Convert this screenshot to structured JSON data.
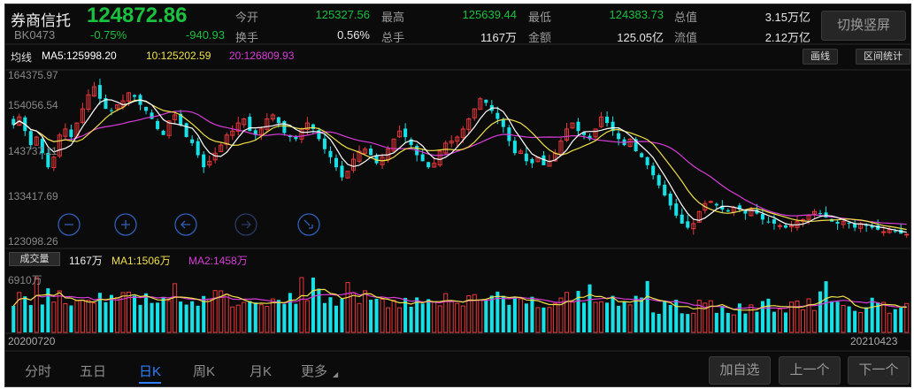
{
  "header": {
    "stock_name": "券商信托",
    "price": "124872.86",
    "code": "BK0473",
    "change_pct": "-0.75%",
    "change_abs": "-940.93",
    "stats": [
      {
        "label": "今开",
        "value": "125327.56",
        "color": "#19c13e"
      },
      {
        "label": "最高",
        "value": "125639.44",
        "color": "#19c13e"
      },
      {
        "label": "最低",
        "value": "124383.73",
        "color": "#19c13e"
      },
      {
        "label": "总值",
        "value": "3.15万亿",
        "color": "#e6e6e6"
      },
      {
        "label": "换手",
        "value": "0.56%",
        "color": "#e6e6e6"
      },
      {
        "label": "总手",
        "value": "1167万",
        "color": "#e6e6e6"
      },
      {
        "label": "金额",
        "value": "125.05亿",
        "color": "#e6e6e6"
      },
      {
        "label": "流值",
        "value": "2.12万亿",
        "color": "#e6e6e6"
      }
    ],
    "switch_button": "切换竖屏"
  },
  "ma_bar": {
    "title": "均线",
    "ma5": "MA5:125998.20",
    "ma10": "10:125202.59",
    "ma20": "20:126809.93",
    "draw_button": "画线",
    "range_button": "区间统计"
  },
  "price_axis": [
    "164375.97",
    "154056.54",
    "143737.11",
    "133417.69",
    "123098.26"
  ],
  "vol_bar": {
    "badge": "成交量",
    "volume": "1167万",
    "ma1": "MA1:1506万",
    "ma2": "MA2:1458万",
    "axis_max": "6910万"
  },
  "dates": {
    "start": "20200720",
    "end": "20210423"
  },
  "tabs": [
    "分时",
    "五日",
    "日K",
    "周K",
    "月K",
    "更多"
  ],
  "active_tab": "日K",
  "buttons": {
    "add_watch": "加自选",
    "prev": "上一个",
    "next": "下一个"
  },
  "colors": {
    "up": "#e8373a",
    "down": "#17e1e6",
    "ma5": "#ffffff",
    "ma10": "#f0e04a",
    "ma20": "#d93cd8",
    "active": "#2f7fff"
  },
  "icons": [
    "zoom-out-icon",
    "zoom-in-icon",
    "scroll-left-icon",
    "scroll-right-icon",
    "reset-zoom-icon"
  ],
  "chart_data": {
    "type": "candlestick",
    "y_range": [
      123098.26,
      164375.97
    ],
    "close": [
      152000,
      154000,
      150500,
      147000,
      149000,
      145000,
      141500,
      144000,
      149500,
      151000,
      149000,
      152500,
      156000,
      159500,
      161500,
      158500,
      156000,
      155500,
      157000,
      158000,
      160000,
      159000,
      157000,
      155500,
      153500,
      151000,
      149500,
      153000,
      154500,
      152000,
      149000,
      147500,
      144500,
      141500,
      143000,
      145000,
      147000,
      149500,
      150500,
      152500,
      153500,
      150500,
      149500,
      151000,
      153500,
      154500,
      152500,
      150000,
      149000,
      148500,
      151000,
      152500,
      151000,
      148500,
      146000,
      144000,
      141500,
      139000,
      140500,
      143500,
      145500,
      146000,
      144500,
      142500,
      144000,
      146000,
      148500,
      150500,
      149000,
      147000,
      144500,
      143000,
      141500,
      142500,
      145500,
      147500,
      148000,
      149000,
      151000,
      153500,
      156000,
      158500,
      157500,
      155500,
      153500,
      151500,
      148000,
      145000,
      145500,
      143000,
      142500,
      144000,
      142000,
      143000,
      145000,
      148000,
      151000,
      152500,
      150500,
      149500,
      148500,
      151000,
      154000,
      152500,
      150500,
      148500,
      147000,
      148500,
      145500,
      144000,
      142000,
      139500,
      137000,
      134500,
      132000,
      129500,
      127500,
      126500,
      127500,
      130500,
      132500,
      133000,
      132000,
      131000,
      130500,
      131500,
      131000,
      130000,
      131000,
      130000,
      128500,
      128000,
      127500,
      127000,
      126500,
      127000,
      128000,
      128500,
      129500,
      130500,
      130000,
      129000,
      128000,
      127500,
      128000,
      127500,
      126500,
      127500,
      127000,
      126500,
      126000,
      125500,
      126000,
      125500,
      125000,
      124872.86
    ],
    "volume_max": 6910
  }
}
